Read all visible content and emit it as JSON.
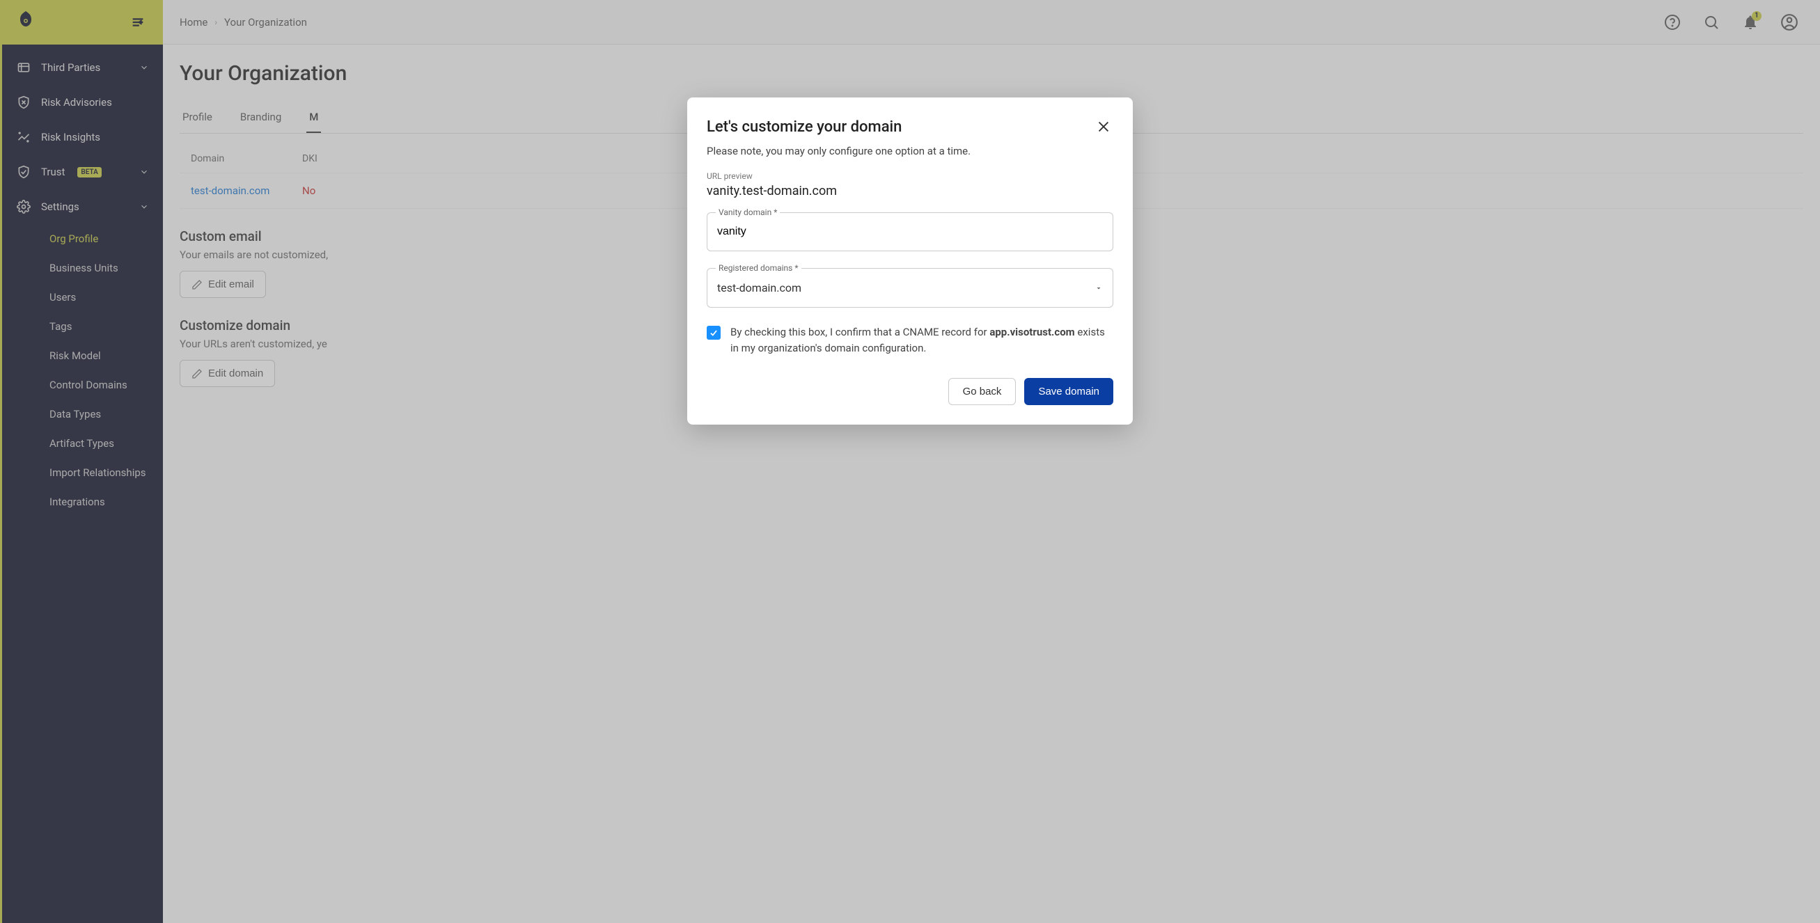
{
  "breadcrumbs": {
    "home": "Home",
    "current": "Your Organization"
  },
  "page_title": "Your Organization",
  "topbar": {
    "notification_count": "1"
  },
  "sidebar": {
    "items": [
      {
        "label": "Third Parties"
      },
      {
        "label": "Risk Advisories"
      },
      {
        "label": "Risk Insights"
      },
      {
        "label": "Trust",
        "beta": "BETA"
      },
      {
        "label": "Settings"
      }
    ],
    "sub_items": [
      {
        "label": "Org Profile"
      },
      {
        "label": "Business Units"
      },
      {
        "label": "Users"
      },
      {
        "label": "Tags"
      },
      {
        "label": "Risk Model"
      },
      {
        "label": "Control Domains"
      },
      {
        "label": "Data Types"
      },
      {
        "label": "Artifact Types"
      },
      {
        "label": "Import Relationships"
      },
      {
        "label": "Integrations"
      }
    ]
  },
  "tabs": [
    {
      "label": "Profile"
    },
    {
      "label": "Branding"
    },
    {
      "label": "M"
    }
  ],
  "table": {
    "headers": {
      "domain": "Domain",
      "dkim": "DKI"
    },
    "row": {
      "domain": "test-domain.com",
      "dkim": "No"
    }
  },
  "sections": {
    "email": {
      "title": "Custom email",
      "desc": "Your emails are not customized,",
      "button": "Edit email"
    },
    "domain": {
      "title": "Customize domain",
      "desc": "Your URLs aren't customized, ye",
      "button": "Edit domain"
    }
  },
  "modal": {
    "title": "Let's customize your domain",
    "note": "Please note, you may only configure one option at a time.",
    "preview_label": "URL preview",
    "preview_value": "vanity.test-domain.com",
    "vanity_label": "Vanity domain",
    "vanity_value": "vanity",
    "registered_label": "Registered domains",
    "registered_value": "test-domain.com",
    "check_text_pre": "By checking this box, I confirm that a CNAME record for ",
    "check_text_bold": "app.visotrust.com",
    "check_text_post": " exists in my organization's domain configuration.",
    "go_back": "Go back",
    "save": "Save domain"
  }
}
